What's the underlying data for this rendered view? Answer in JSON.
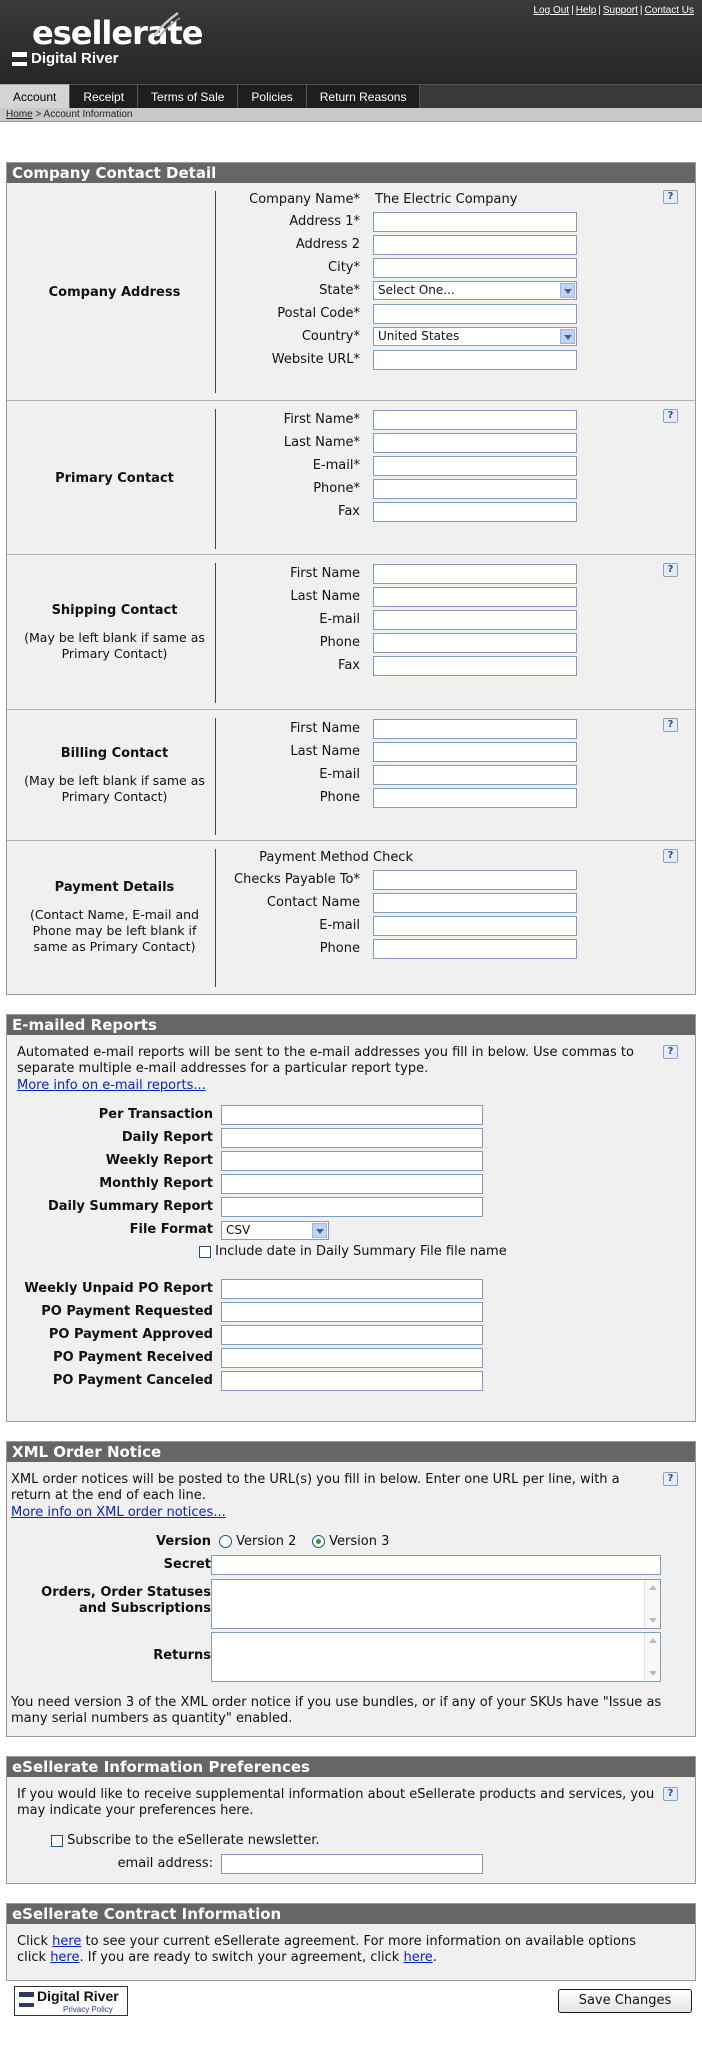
{
  "header": {
    "brand": "esellerate",
    "brand_sub": "Digital River",
    "links": [
      "Log Out",
      "Help",
      "Support",
      "Contact Us"
    ]
  },
  "tabs": [
    "Account",
    "Receipt",
    "Terms of Sale",
    "Policies",
    "Return Reasons"
  ],
  "active_tab": "Account",
  "breadcrumb": {
    "home": "Home",
    "current": "> Account Information"
  },
  "company": {
    "title": "Company Contact Detail",
    "address": {
      "heading": "Company Address",
      "company_name_label": "Company Name*",
      "company_name_value": "The Electric Company",
      "address1": "Address 1*",
      "address2": "Address 2",
      "city": "City*",
      "state": "State*",
      "state_value": "Select One...",
      "postal": "Postal Code*",
      "country": "Country*",
      "country_value": "United States",
      "website": "Website URL*"
    },
    "primary": {
      "heading": "Primary Contact",
      "first": "First Name*",
      "last": "Last Name*",
      "email": "E-mail*",
      "phone": "Phone*",
      "fax": "Fax"
    },
    "shipping": {
      "heading": "Shipping Contact",
      "sub": "(May be left blank if same as Primary Contact)",
      "first": "First Name",
      "last": "Last Name",
      "email": "E-mail",
      "phone": "Phone",
      "fax": "Fax"
    },
    "billing": {
      "heading": "Billing Contact",
      "sub": "(May be left blank if same as Primary Contact)",
      "first": "First Name",
      "last": "Last Name",
      "email": "E-mail",
      "phone": "Phone"
    },
    "payment": {
      "heading": "Payment Details",
      "sub": "(Contact Name, E-mail and Phone may be left blank if same as Primary Contact)",
      "method": "Payment Method Check",
      "payable": "Checks Payable To*",
      "contact": "Contact Name",
      "email": "E-mail",
      "phone": "Phone"
    }
  },
  "reports": {
    "title": "E-mailed Reports",
    "intro": "Automated e-mail reports will be sent to the e-mail addresses you fill in below. Use commas to separate multiple e-mail addresses for a particular report type.",
    "more_link": "More info on e-mail reports...",
    "fields": [
      "Per Transaction",
      "Daily Report",
      "Weekly Report",
      "Monthly Report",
      "Daily Summary Report"
    ],
    "file_format_label": "File Format",
    "file_format_value": "CSV",
    "include_date": "Include date in Daily Summary File file name",
    "po_fields": [
      "Weekly Unpaid PO Report",
      "PO Payment Requested",
      "PO Payment Approved",
      "PO Payment Received",
      "PO Payment Canceled"
    ]
  },
  "xml": {
    "title": "XML Order Notice",
    "intro": "XML order notices will be posted to the URL(s) you fill in below. Enter one URL per line, with a return at the end of each line.",
    "more_link": "More info on XML order notices...",
    "version_label": "Version",
    "v2": "Version 2",
    "v3": "Version 3",
    "secret": "Secret",
    "orders_label1": "Orders, Order Statuses",
    "orders_label2": "and Subscriptions",
    "returns": "Returns",
    "note": "You need version 3 of the XML order notice if you use bundles, or if any of your SKUs have \"Issue as many serial numbers as quantity\" enabled."
  },
  "prefs": {
    "title": "eSellerate Information Preferences",
    "intro": "If you would like to receive supplemental information about eSellerate products and services, you may indicate your preferences here.",
    "subscribe": "Subscribe to the eSellerate newsletter.",
    "email_label": "email address:"
  },
  "contract": {
    "title": "eSellerate Contract Information",
    "t1": "Click ",
    "here1": "here",
    "t2": " to see your current eSellerate agreement. For more information on available options click ",
    "here2": "here",
    "t3": ". If you are ready to switch your agreement, click ",
    "here3": "here",
    "t4": "."
  },
  "footer": {
    "badge_title": "Digital River",
    "badge_sub": "Privacy Policy",
    "save": "Save Changes"
  }
}
